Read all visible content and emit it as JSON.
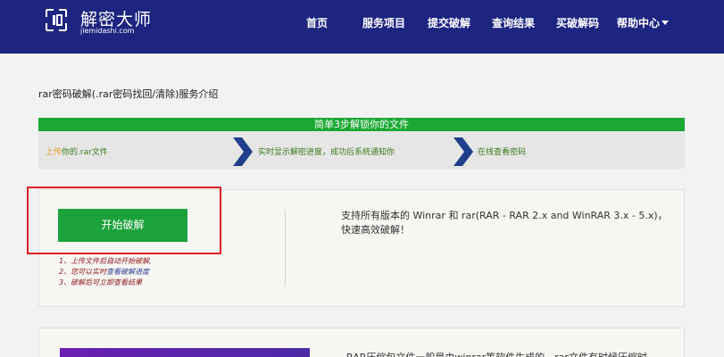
{
  "header": {
    "logo_text": "解密大师",
    "logo_sub": "jiemidashi.com",
    "nav": [
      {
        "label": "首页"
      },
      {
        "label": "服务项目"
      },
      {
        "label": "提交破解"
      },
      {
        "label": "查询结果"
      },
      {
        "label": "买破解码"
      },
      {
        "label": "帮助中心"
      }
    ]
  },
  "main": {
    "title": "rar密码破解(.rar密码找回/清除)服务介绍",
    "steps_title": "简单3步解锁你的文件",
    "steps": [
      {
        "highlight": "上传",
        "rest": "你的.rar文件"
      },
      {
        "highlight": "",
        "rest": "实时显示解密进度，成功后系统通知你"
      },
      {
        "highlight": "",
        "rest": "在线查看密码"
      }
    ],
    "start_button": "开始破解",
    "notes": [
      {
        "prefix": "1、",
        "text": "上传文件后自动开始破解,",
        "link": ""
      },
      {
        "prefix": "2、",
        "text": "您可以实时",
        "link": "查看破解进度"
      },
      {
        "prefix": "3、",
        "text": "破解后可立即查看结果",
        "link": ""
      }
    ],
    "description": "支持所有版本的 Winrar 和 rar(RAR - RAR 2.x and WinRAR 3.x - 5.x)，快速高效破解！",
    "card2_text": "RAR压缩包文件一般是由winrar等软件生成的，rar文件有时候压缩时"
  },
  "colors": {
    "header_bg": "#1d2580",
    "green": "#1aa833",
    "button_green": "#1ca23a",
    "highlight_frame": "#e01f26",
    "chevron_blue": "#1f3f8a"
  },
  "icons": [
    "logo-icon",
    "chevron-right-icon",
    "caret-down-icon"
  ]
}
